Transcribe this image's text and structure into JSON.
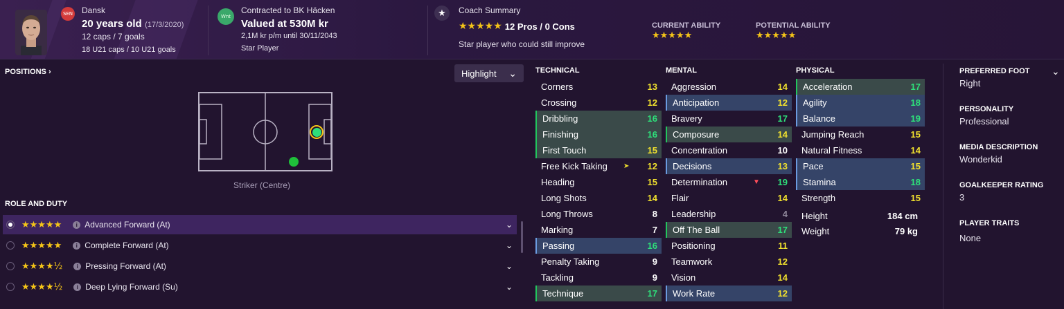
{
  "header": {
    "nationality": "Dansk",
    "nationality_badge": "SEN",
    "age": "20 years old",
    "dob": "(17/3/2020)",
    "caps": "12 caps / 7 goals",
    "u21_caps": "18 U21 caps / 10 U21 goals",
    "club_badge": "Wnt",
    "contract": "Contracted to BK Häcken",
    "value": "Valued at 530M kr",
    "wage": "2,1M kr p/m until 30/11/2043",
    "status": "Star Player",
    "coach_title": "Coach Summary",
    "coach_stars": "★★★★★",
    "coach_pros_cons": "12 Pros / 0 Cons",
    "coach_desc": "Star player who could still improve",
    "current_ability_label": "CURRENT ABILITY",
    "current_ability_stars": "★★★★★",
    "potential_ability_label": "POTENTIAL ABILITY",
    "potential_ability_stars": "★★★★★"
  },
  "positions": {
    "title": "POSITIONS",
    "title_chevron": "›",
    "highlight_label": "Highlight",
    "highlight_chevron": "⌄",
    "caption": "Striker (Centre)"
  },
  "roles": {
    "title": "ROLE AND DUTY",
    "items": [
      {
        "stars": "★★★★★",
        "label": "Advanced Forward (At)"
      },
      {
        "stars": "★★★★★",
        "label": "Complete Forward (At)"
      },
      {
        "stars": "★★★★½",
        "label": "Pressing Forward (At)"
      },
      {
        "stars": "★★★★½",
        "label": "Deep Lying Forward (Su)"
      }
    ],
    "chevron": "⌄",
    "info": "i"
  },
  "technical": {
    "title": "TECHNICAL",
    "rows": [
      {
        "name": "Corners",
        "value": "13"
      },
      {
        "name": "Crossing",
        "value": "12"
      },
      {
        "name": "Dribbling",
        "value": "16"
      },
      {
        "name": "Finishing",
        "value": "16"
      },
      {
        "name": "First Touch",
        "value": "15"
      },
      {
        "name": "Free Kick Taking",
        "value": "12"
      },
      {
        "name": "Heading",
        "value": "15"
      },
      {
        "name": "Long Shots",
        "value": "14"
      },
      {
        "name": "Long Throws",
        "value": "8"
      },
      {
        "name": "Marking",
        "value": "7"
      },
      {
        "name": "Passing",
        "value": "16"
      },
      {
        "name": "Penalty Taking",
        "value": "9"
      },
      {
        "name": "Tackling",
        "value": "9"
      },
      {
        "name": "Technique",
        "value": "17"
      }
    ]
  },
  "mental": {
    "title": "MENTAL",
    "rows": [
      {
        "name": "Aggression",
        "value": "14"
      },
      {
        "name": "Anticipation",
        "value": "12"
      },
      {
        "name": "Bravery",
        "value": "17"
      },
      {
        "name": "Composure",
        "value": "14"
      },
      {
        "name": "Concentration",
        "value": "10"
      },
      {
        "name": "Decisions",
        "value": "13"
      },
      {
        "name": "Determination",
        "value": "19"
      },
      {
        "name": "Flair",
        "value": "14"
      },
      {
        "name": "Leadership",
        "value": "4"
      },
      {
        "name": "Off The Ball",
        "value": "17"
      },
      {
        "name": "Positioning",
        "value": "11"
      },
      {
        "name": "Teamwork",
        "value": "12"
      },
      {
        "name": "Vision",
        "value": "14"
      },
      {
        "name": "Work Rate",
        "value": "12"
      }
    ]
  },
  "physical": {
    "title": "PHYSICAL",
    "rows": [
      {
        "name": "Acceleration",
        "value": "17"
      },
      {
        "name": "Agility",
        "value": "18"
      },
      {
        "name": "Balance",
        "value": "19"
      },
      {
        "name": "Jumping Reach",
        "value": "15"
      },
      {
        "name": "Natural Fitness",
        "value": "14"
      },
      {
        "name": "Pace",
        "value": "15"
      },
      {
        "name": "Stamina",
        "value": "18"
      },
      {
        "name": "Strength",
        "value": "15"
      }
    ],
    "height_label": "Height",
    "height_value": "184 cm",
    "weight_label": "Weight",
    "weight_value": "79 kg"
  },
  "info": {
    "preferred_foot_label": "PREFERRED FOOT",
    "preferred_foot": "Right",
    "personality_label": "PERSONALITY",
    "personality": "Professional",
    "media_label": "MEDIA DESCRIPTION",
    "media": "Wonderkid",
    "gk_label": "GOALKEEPER RATING",
    "gk": "3",
    "traits_label": "PLAYER TRAITS",
    "traits": "None",
    "chevron": "⌄"
  },
  "colors": {
    "background": "#22142f",
    "green_highlight": "#22c55e",
    "blue_highlight": "#6b9be0",
    "value_yellow": "#f1e12e",
    "value_green": "#2ee07a",
    "star": "#f5c518"
  }
}
